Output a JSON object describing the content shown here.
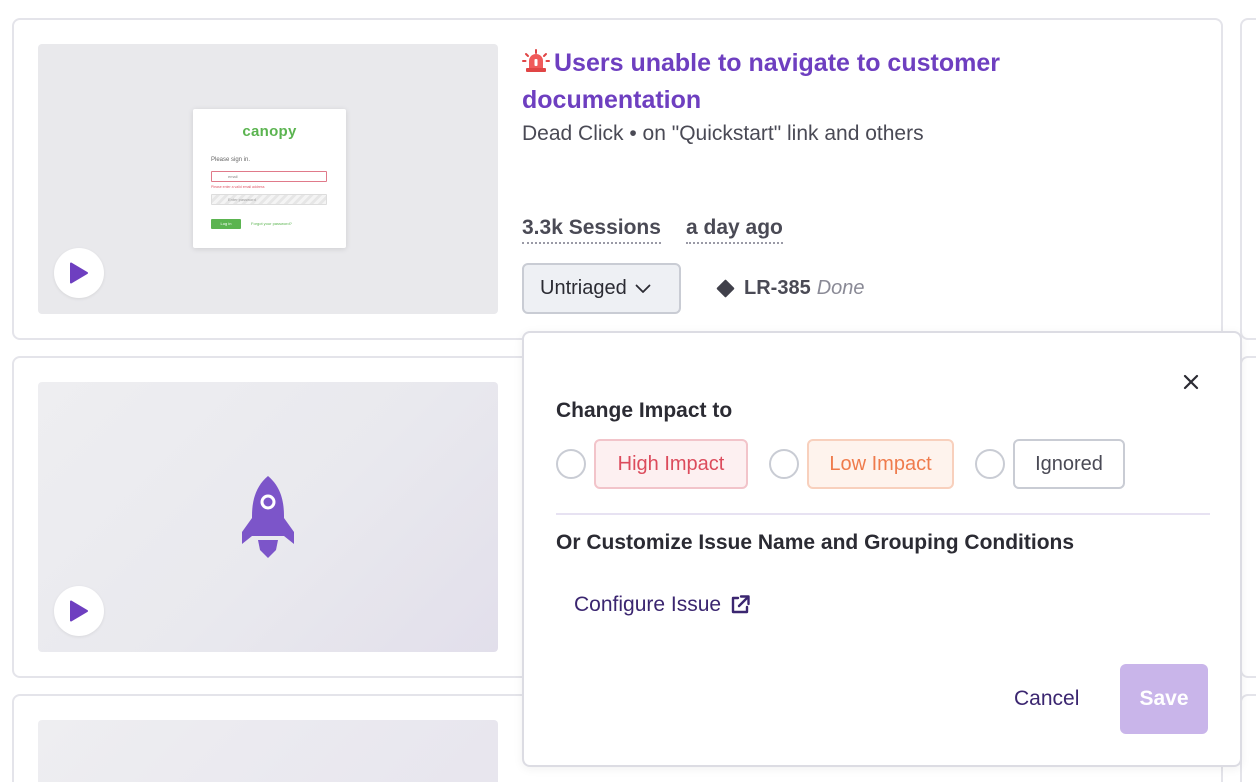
{
  "issue": {
    "title": "Users unable to navigate to customer documentation",
    "subtitle": "Dead Click • on \"Quickstart\" link and others",
    "sessions": "3.3k Sessions",
    "last_seen": "a day ago",
    "triage_status": "Untriaged",
    "ticket_key": "LR-385",
    "ticket_status": "Done",
    "severity_icon": "siren-icon"
  },
  "thumbnail_1": {
    "app_logo": "canopy",
    "signin_text": "Please sign in.",
    "email_value": "email",
    "error_text": "Please enter a valid email address",
    "password_placeholder": "Enter password",
    "login_label": "Log in",
    "forgot_label": "Forgot your password?"
  },
  "thumbnail_2": {
    "icon": "rocket-icon"
  },
  "popover": {
    "heading": "Change Impact to",
    "options": [
      {
        "label": "High Impact",
        "color": "#dc4b5c"
      },
      {
        "label": "Low Impact",
        "color": "#ef7b4c"
      },
      {
        "label": "Ignored",
        "color": "#4a4a55"
      }
    ],
    "subheading": "Or Customize Issue Name and Grouping Conditions",
    "configure_label": "Configure Issue",
    "cancel_label": "Cancel",
    "save_label": "Save"
  },
  "colors": {
    "accent": "#6e3fc0",
    "save_disabled": "#c9b5ea",
    "link": "#3b2670"
  }
}
